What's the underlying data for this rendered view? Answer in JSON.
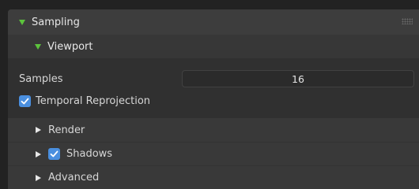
{
  "panel": {
    "title": "Sampling",
    "grip_icon": "drag-grip-icon"
  },
  "subpanel": {
    "title": "Viewport"
  },
  "samples": {
    "label": "Samples",
    "value": "16"
  },
  "temporal": {
    "label": "Temporal Reprojection",
    "checked": true
  },
  "collapsed_sections": [
    {
      "label": "Render",
      "has_checkbox": false
    },
    {
      "label": "Shadows",
      "has_checkbox": true,
      "checked": true
    },
    {
      "label": "Advanced",
      "has_checkbox": false
    }
  ],
  "colors": {
    "accent_green": "#5cc33c",
    "checkbox_blue": "#4a8fdf",
    "background": "#303030"
  }
}
